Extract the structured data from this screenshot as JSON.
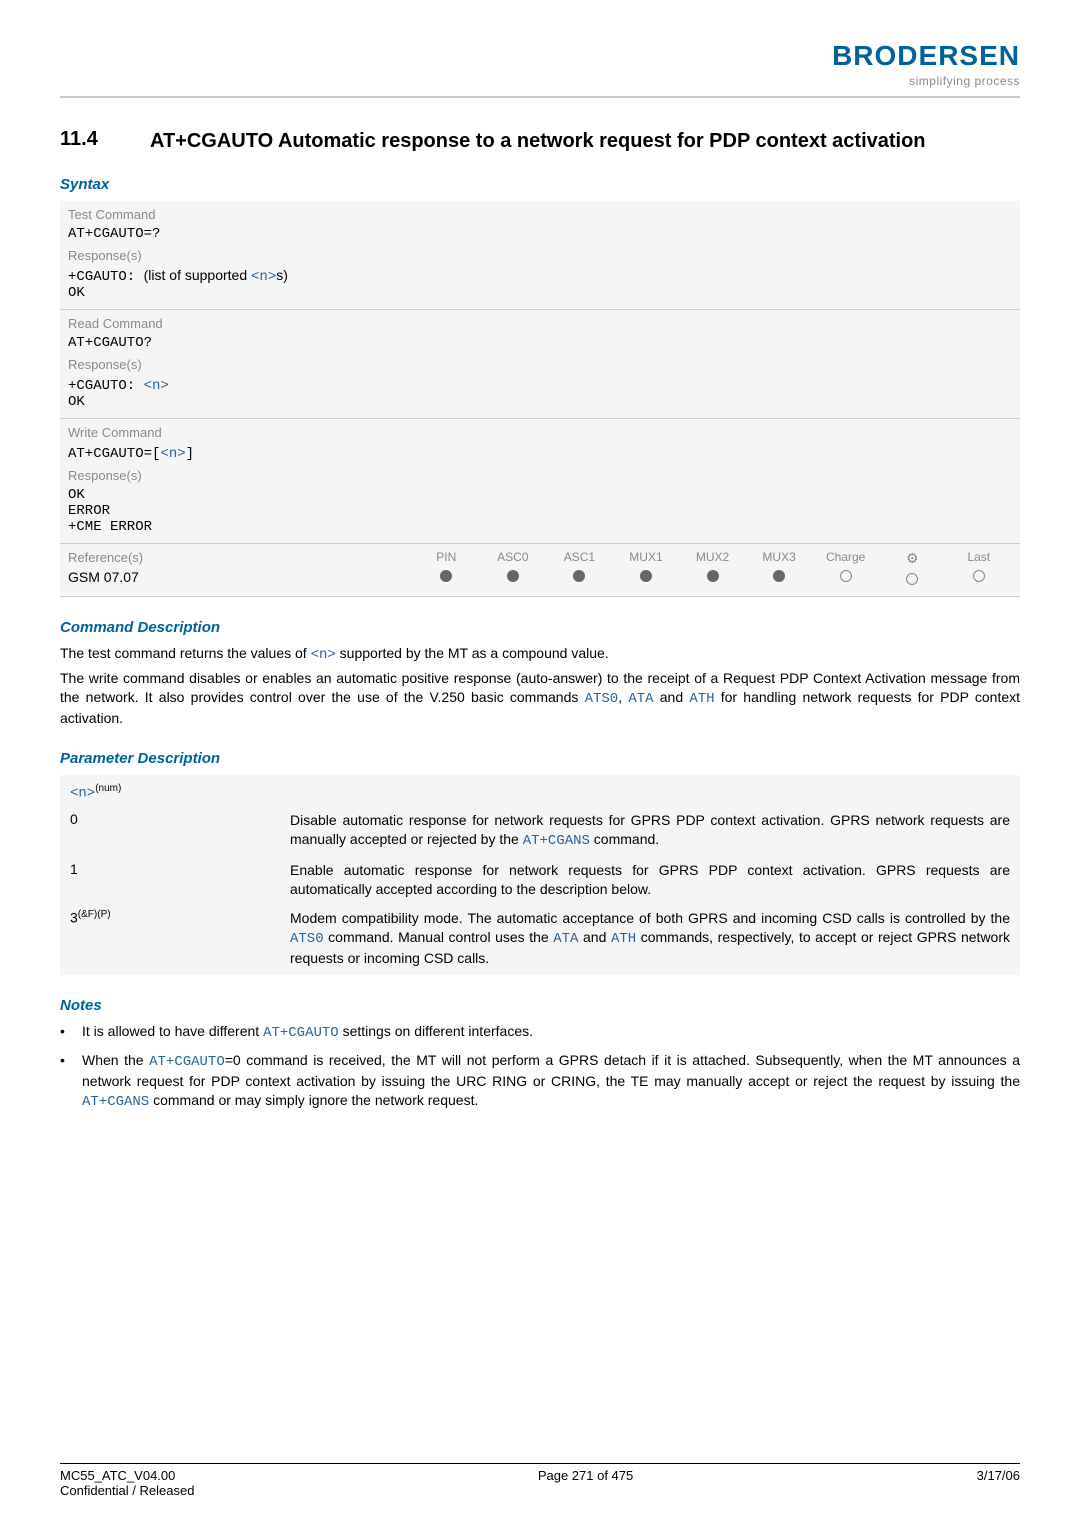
{
  "header": {
    "brand": "BRODERSEN",
    "tagline": "simplifying process"
  },
  "section": {
    "number": "11.4",
    "title": "AT+CGAUTO   Automatic response to a network request for PDP context activation"
  },
  "syntax": {
    "heading": "Syntax",
    "test": {
      "label": "Test Command",
      "cmd": "AT+CGAUTO=?",
      "resp_label": "Response(s)",
      "resp_prefix": "+CGAUTO: ",
      "resp_text1": "(list of supported ",
      "resp_param": "<n>",
      "resp_text2": "s)",
      "ok": "OK"
    },
    "read": {
      "label": "Read Command",
      "cmd": "AT+CGAUTO?",
      "resp_label": "Response(s)",
      "resp_prefix": "+CGAUTO: ",
      "resp_param": "<n>",
      "ok": "OK"
    },
    "write": {
      "label": "Write Command",
      "cmd_prefix": "AT+CGAUTO=[",
      "cmd_param": "<n>",
      "cmd_suffix": "]",
      "resp_label": "Response(s)",
      "l1": "OK",
      "l2": "ERROR",
      "l3": "+CME ERROR"
    },
    "ref": {
      "label": "Reference(s)",
      "value": "GSM 07.07",
      "cols": [
        "PIN",
        "ASC0",
        "ASC1",
        "MUX1",
        "MUX2",
        "MUX3",
        "Charge",
        "⚙",
        "Last"
      ],
      "states": [
        "filled",
        "filled",
        "filled",
        "filled",
        "filled",
        "filled",
        "open",
        "open",
        "open"
      ]
    }
  },
  "cmd_desc": {
    "heading": "Command Description",
    "p1a": "The test command returns the values of ",
    "p1param": "<n>",
    "p1b": " supported by the MT as a compound value.",
    "p2a": "The write command disables or enables an automatic positive response (auto-answer) to the receipt of a Request PDP Context Activation message from the network. It also provides control over the use of the V.250 basic commands ",
    "c1": "ATS0",
    "sep1": ", ",
    "c2": "ATA",
    "sep2": " and ",
    "c3": "ATH",
    "p2b": " for handling network requests for PDP context activation."
  },
  "param_desc": {
    "heading": "Parameter Description",
    "head_param": "<n>",
    "head_sup": "(num)",
    "rows": [
      {
        "k": "0",
        "ta": "Disable automatic response for network requests for GPRS PDP context activation. GPRS network requests are manually accepted or rejected by the ",
        "cmd": "AT+CGANS",
        "tb": " command."
      },
      {
        "k": "1",
        "ta": "Enable automatic response for network requests for GPRS PDP context activation. GPRS requests are automatically accepted according to the description below.",
        "cmd": "",
        "tb": ""
      }
    ],
    "row3": {
      "k": "3",
      "ksup": "(&F)(P)",
      "ta": "Modem compatibility mode. The automatic acceptance of both GPRS and incoming CSD calls is controlled by the ",
      "c1": "ATS0",
      "tb": " command. Manual control uses the ",
      "c2": "ATA",
      "tc": " and ",
      "c3": "ATH",
      "td": " commands, respectively, to accept or reject GPRS network requests or incoming CSD calls."
    }
  },
  "notes": {
    "heading": "Notes",
    "n1a": "It is allowed to have different ",
    "n1cmd": "AT+CGAUTO",
    "n1b": " settings on different interfaces.",
    "n2a": "When the ",
    "n2cmd1": "AT+CGAUTO",
    "n2b": "=0 command is received, the MT will not perform a GPRS detach if it is attached. Subsequently, when the MT announces a network request for PDP context activation by issuing the URC RING or CRING, the TE may manually accept or reject the request by issuing the ",
    "n2cmd2": "AT+CGANS",
    "n2c": " command or may simply ignore the network request."
  },
  "footer": {
    "doc": "MC55_ATC_V04.00",
    "conf": "Confidential / Released",
    "page": "Page 271 of 475",
    "date": "3/17/06"
  }
}
